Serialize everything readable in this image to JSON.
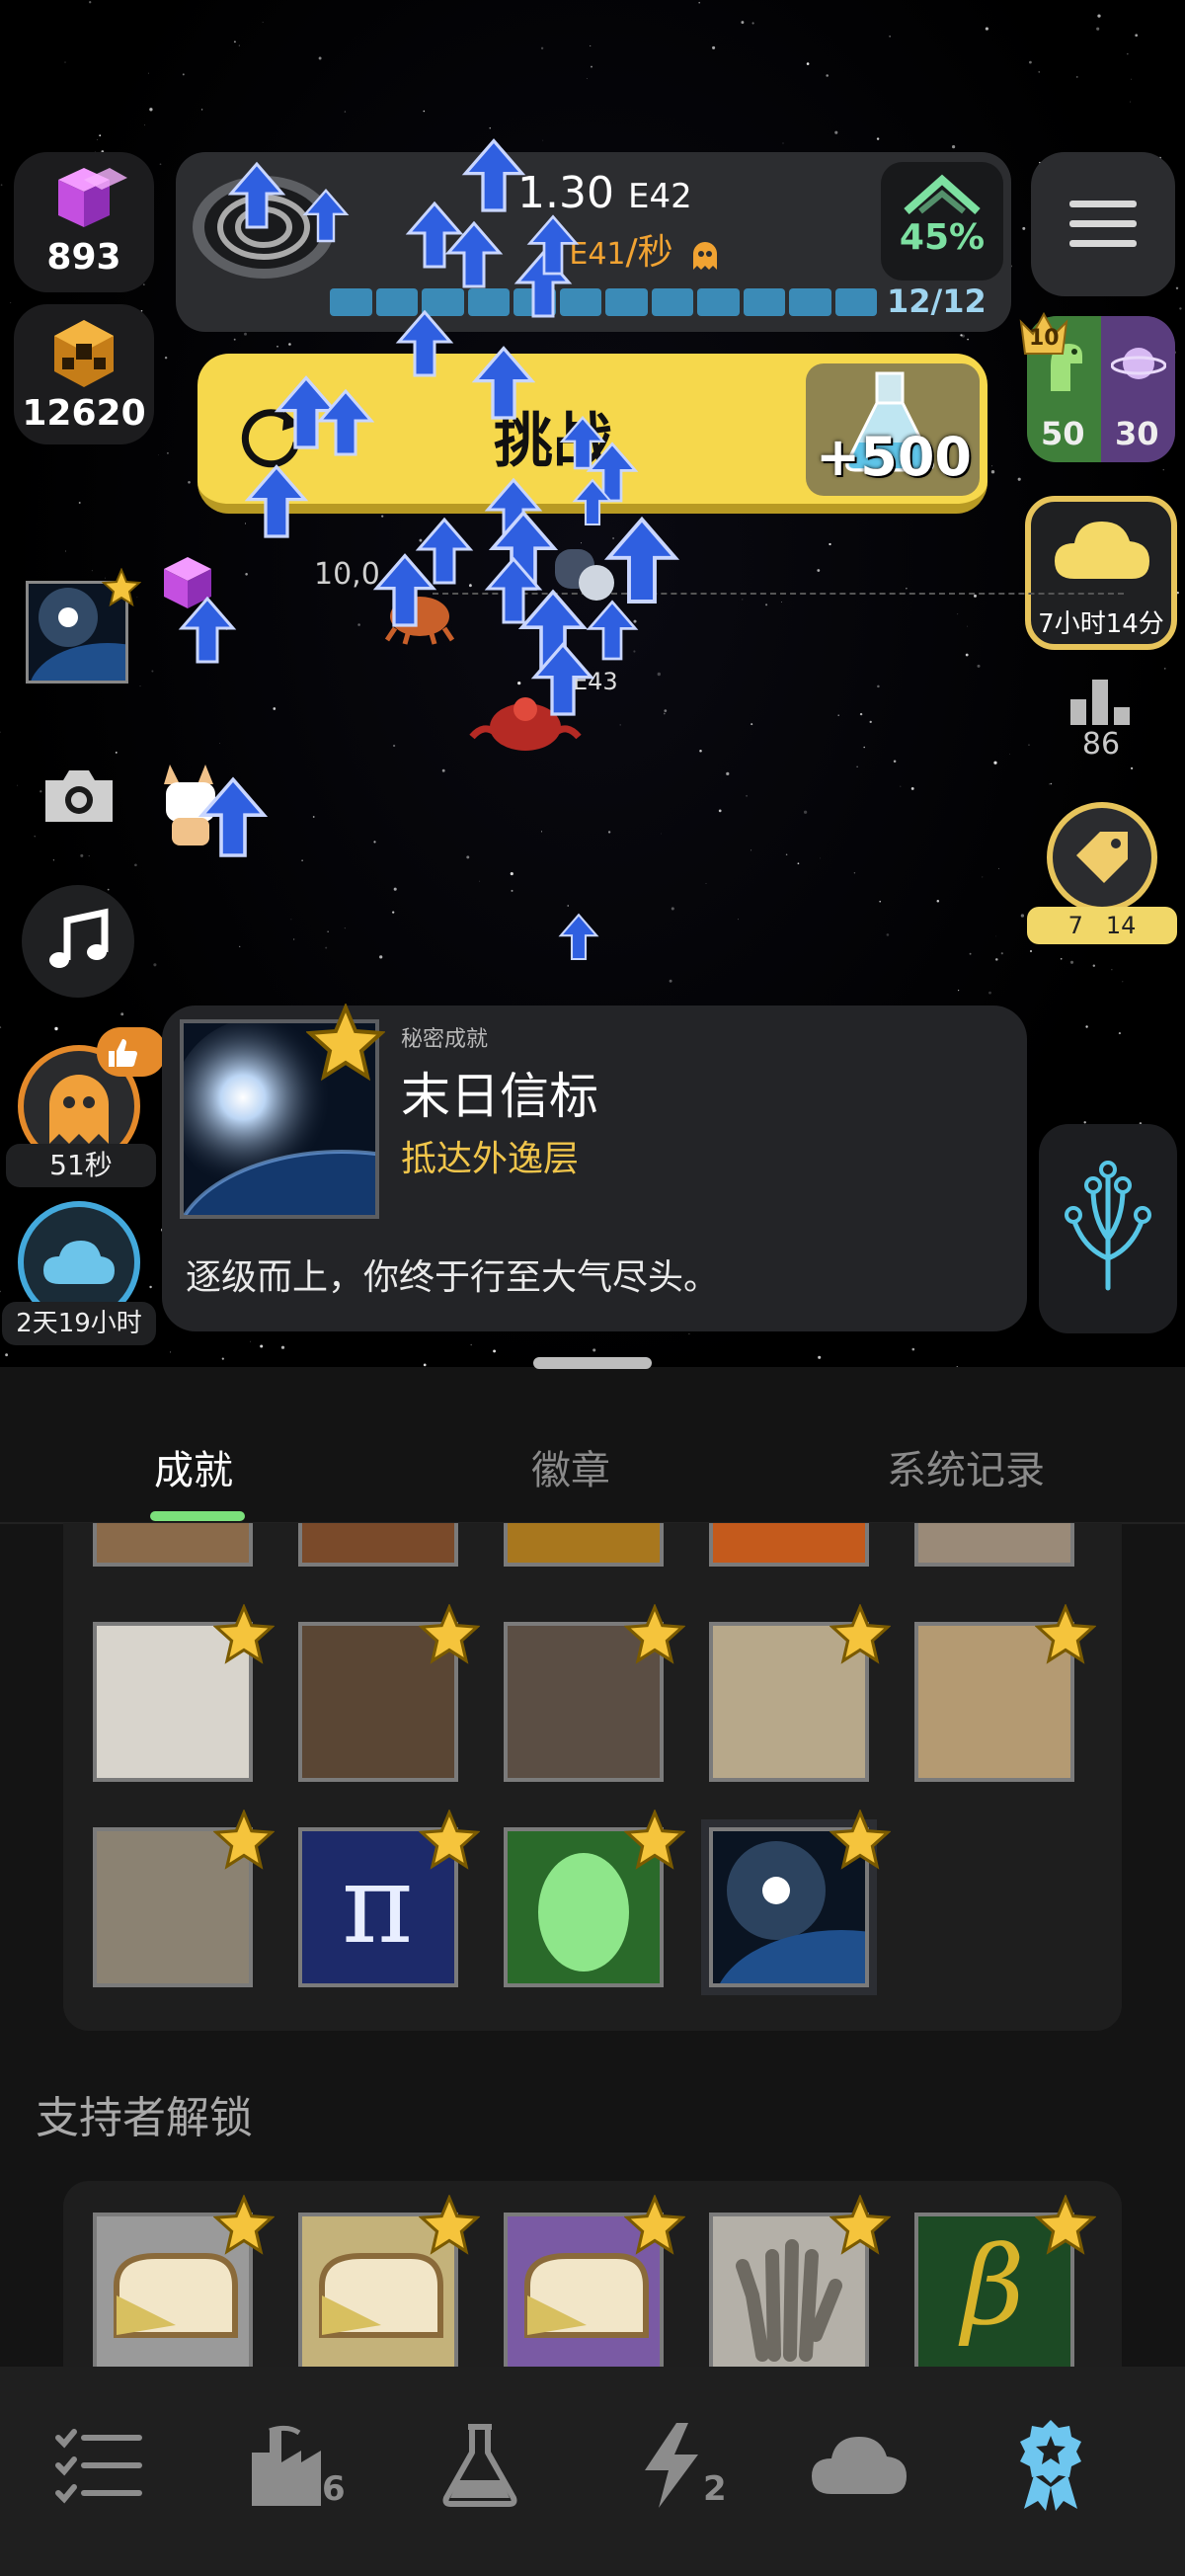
{
  "resources": {
    "cubes": "893",
    "gear_blocks": "12620"
  },
  "production": {
    "total_mantissa": "1.30",
    "total_exp": "E42",
    "rate_prefix": "1",
    "rate_exp": "E41",
    "rate_unit": "/秒",
    "progress_count": "12/12",
    "progress_fraction": 1.0,
    "boost_pct": "45%"
  },
  "challenge": {
    "label": "挑战",
    "reward": "+500"
  },
  "milestones": {
    "badge_level": "10",
    "dino_count": "50",
    "planet_count": "30"
  },
  "weather": {
    "time_left": "7小时14分"
  },
  "rank": {
    "value": "86"
  },
  "tag": {
    "left": "7",
    "right": "14"
  },
  "left_timers": {
    "ghost_time": "51秒",
    "cloud_time": "2天19小时"
  },
  "scene": {
    "marker_value": "10,0",
    "label_value": "E43"
  },
  "toast": {
    "tag": "秘密成就",
    "title": "末日信标",
    "subtitle": "抵达外逸层",
    "description": "逐级而上，你终于行至大气尽头。"
  },
  "tabs": [
    {
      "label": "成就",
      "active": true
    },
    {
      "label": "徽章",
      "active": false
    },
    {
      "label": "系统记录",
      "active": false
    }
  ],
  "achievements": {
    "row_partial": [
      "cut-1",
      "cut-2",
      "cut-3",
      "cut-4",
      "cut-5"
    ],
    "row1": [
      "alpaca",
      "astrolabe",
      "locomotive",
      "telescope",
      "sailboat"
    ],
    "row2": [
      "caveman",
      "pi",
      "green-egg",
      "earth-sunrise"
    ]
  },
  "supporter": {
    "title": "支持者解锁",
    "items": [
      "toast-plain",
      "toast-yellow",
      "toast-purple",
      "hand-print",
      "beta"
    ]
  },
  "nav": {
    "items": [
      "tasks-icon",
      "factory-icon",
      "flask-icon",
      "lightning-icon",
      "cloud-icon",
      "badge-icon"
    ],
    "factory_badge": "6",
    "lightning_badge": "2",
    "active_color": "#6ec6ef"
  },
  "colors": {
    "accent_green": "#7be07b",
    "gold": "#f0c54b",
    "challenge_yellow": "#f6d84c",
    "progress_blue": "#3b8bb7"
  }
}
